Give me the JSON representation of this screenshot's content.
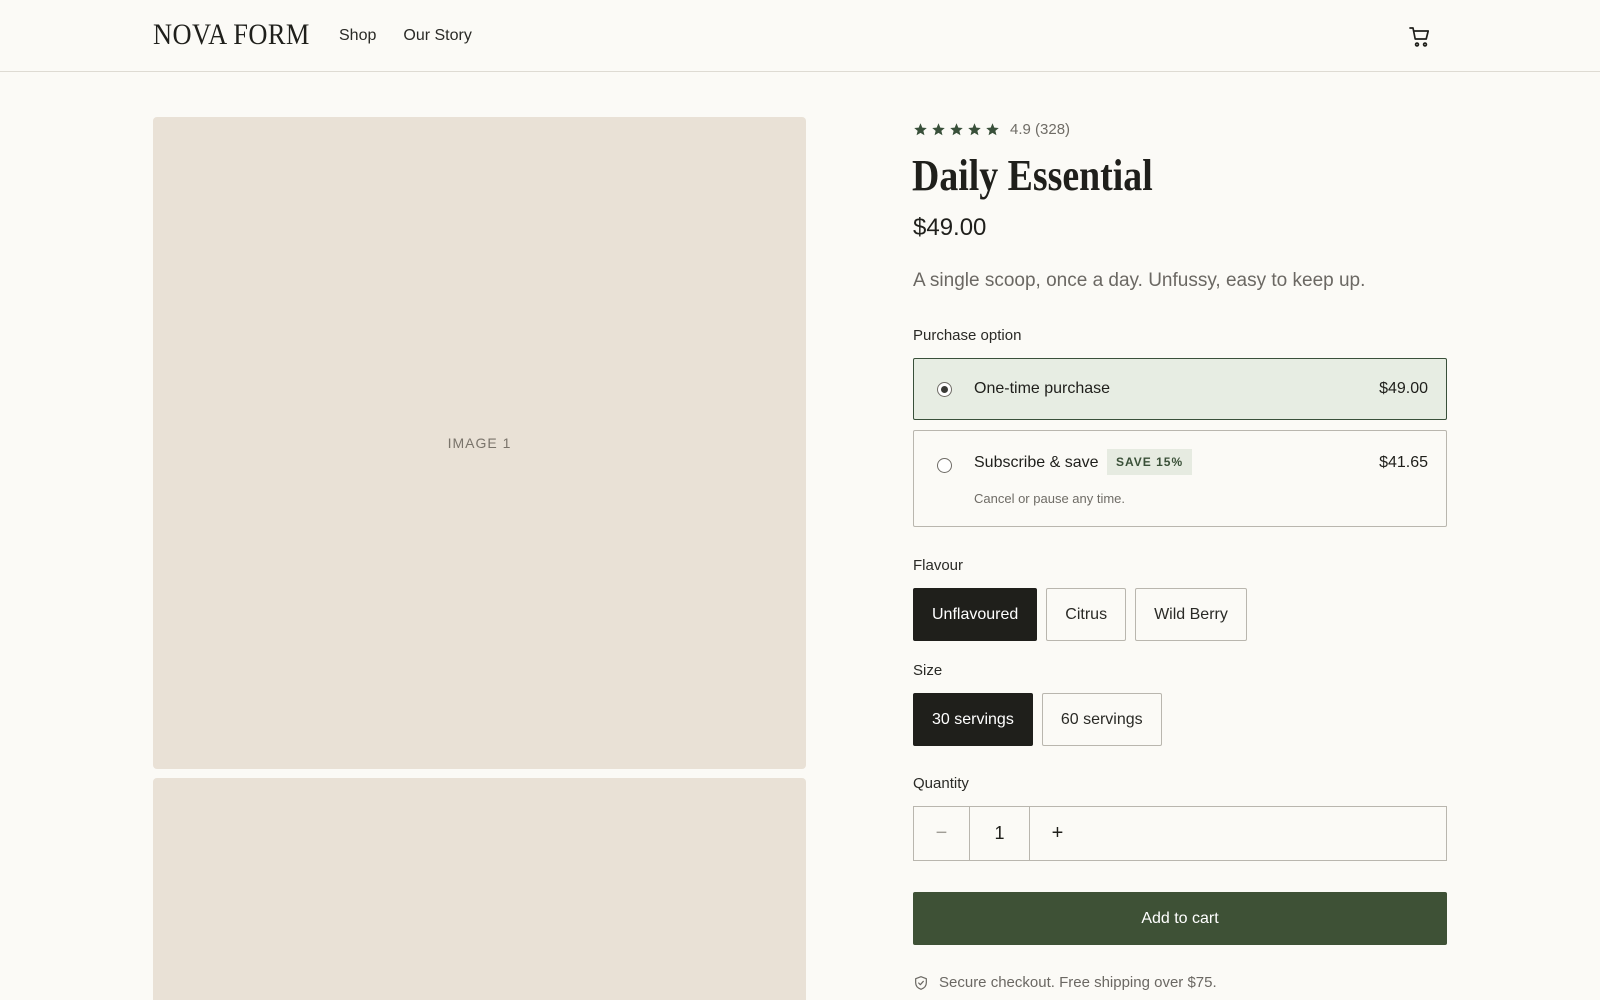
{
  "header": {
    "logo": "NOVA FORM",
    "nav": [
      "Shop",
      "Our Story"
    ],
    "cart_icon": "cart-icon"
  },
  "gallery": {
    "images": [
      "IMAGE 1",
      ""
    ]
  },
  "product": {
    "rating_value": 4.9,
    "rating_text": "4.9 (328)",
    "title": "Daily Essential",
    "price": "$49.00",
    "description": "A single scoop, once a day. Unfussy, easy to keep up."
  },
  "purchase": {
    "label": "Purchase option",
    "options": [
      {
        "name": "One-time purchase",
        "price": "$49.00",
        "selected": true
      },
      {
        "name": "Subscribe & save",
        "badge": "SAVE 15%",
        "price": "$41.65",
        "note": "Cancel or pause any time.",
        "selected": false
      }
    ]
  },
  "flavour": {
    "label": "Flavour",
    "options": [
      "Unflavoured",
      "Citrus",
      "Wild Berry"
    ],
    "selected": "Unflavoured"
  },
  "size": {
    "label": "Size",
    "options": [
      "30 servings",
      "60 servings"
    ],
    "selected": "30 servings"
  },
  "quantity": {
    "label": "Quantity",
    "value": "1",
    "minus": "−",
    "plus": "+"
  },
  "cta": {
    "label": "Add to cart"
  },
  "secure": {
    "text": "Secure checkout. Free shipping over $75.",
    "icon": "shield-check-icon"
  },
  "colors": {
    "accent": "#3e5136",
    "selected_chip": "#1f1f1b",
    "image_placeholder": "#e9e1d6",
    "background": "#fbfaf6"
  }
}
